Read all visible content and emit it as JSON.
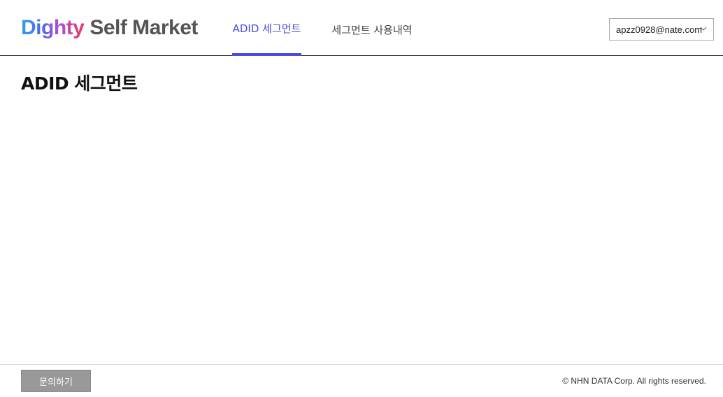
{
  "header": {
    "logo": {
      "brand": "Dighty",
      "product": "Self Market"
    },
    "tabs": [
      {
        "label": "ADID 세그먼트",
        "active": true
      },
      {
        "label": "세그먼트 사용내역",
        "active": false
      }
    ],
    "account": {
      "email": "apzz0928@nate.com",
      "icon": "chevron-down-icon"
    }
  },
  "main": {
    "title": "ADID 세그먼트"
  },
  "footer": {
    "inquiry_label": "문의하기",
    "copyright": "© NHN DATA Corp. All rights reserved."
  },
  "colors": {
    "accent": "#4a4ce0",
    "button_gray": "#999999"
  }
}
